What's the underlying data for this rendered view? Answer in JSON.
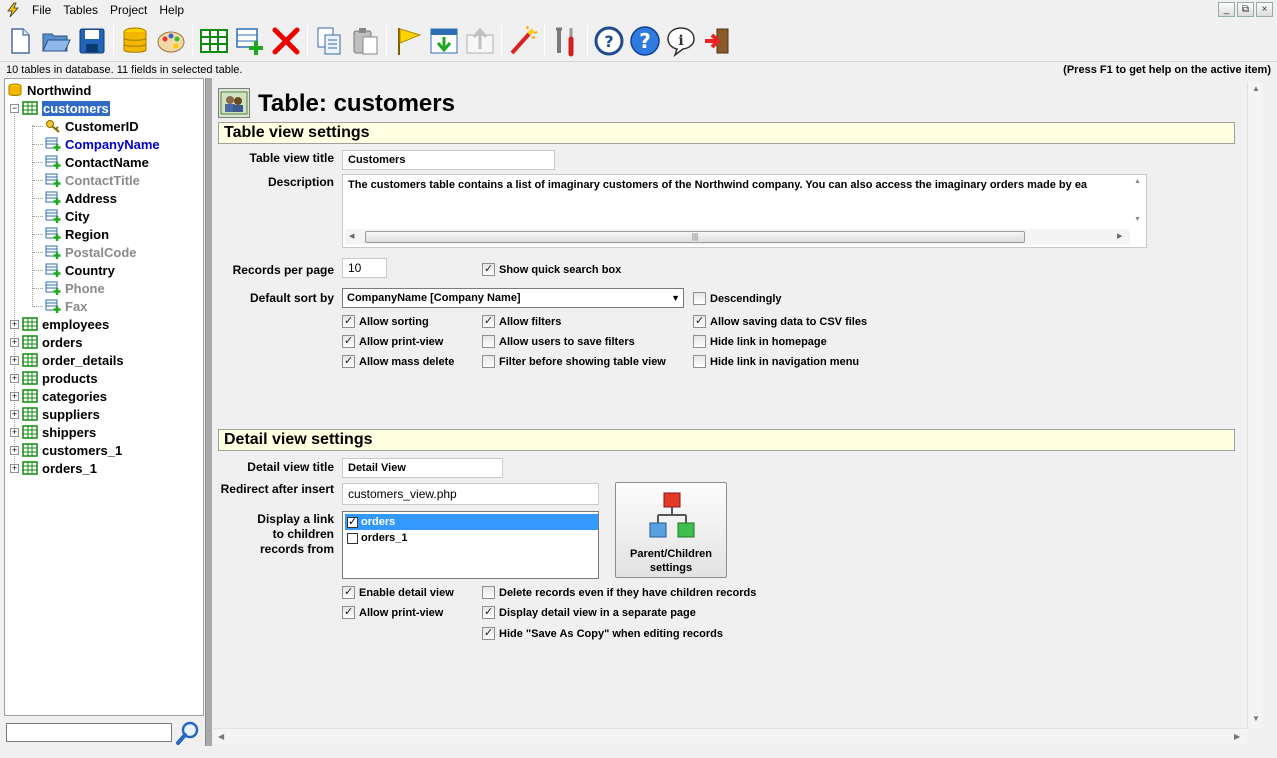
{
  "menu": [
    "File",
    "Tables",
    "Project",
    "Help"
  ],
  "window_controls": [
    "_",
    "⧉",
    "×"
  ],
  "status": {
    "left": "10 tables in database. 11 fields in selected table.",
    "right": "(Press F1 to get help on the active item)"
  },
  "tree": {
    "root": "Northwind",
    "selected_table": "customers",
    "fields": [
      {
        "name": "CustomerID",
        "state": "key"
      },
      {
        "name": "CompanyName",
        "state": "active"
      },
      {
        "name": "ContactName",
        "state": "normal"
      },
      {
        "name": "ContactTitle",
        "state": "dim"
      },
      {
        "name": "Address",
        "state": "normal"
      },
      {
        "name": "City",
        "state": "normal"
      },
      {
        "name": "Region",
        "state": "normal"
      },
      {
        "name": "PostalCode",
        "state": "dim"
      },
      {
        "name": "Country",
        "state": "normal"
      },
      {
        "name": "Phone",
        "state": "dim"
      },
      {
        "name": "Fax",
        "state": "dim"
      }
    ],
    "tables": [
      "employees",
      "orders",
      "order_details",
      "products",
      "categories",
      "suppliers",
      "shippers",
      "customers_1",
      "orders_1"
    ]
  },
  "main": {
    "title": "Table: customers",
    "table_view": {
      "heading": "Table view settings",
      "title_label": "Table view title",
      "title_value": "Customers",
      "description_label": "Description",
      "description_value": "The customers table contains a list of imaginary customers of the Northwind company. You can also access the imaginary orders made by ea",
      "records_label": "Records per page",
      "records_value": "10",
      "quick_search": "Show quick search box",
      "sort_label": "Default sort by",
      "sort_value": "CompanyName [Company Name]",
      "descending": "Descendingly",
      "checkboxes": [
        {
          "label": "Allow sorting",
          "checked": true
        },
        {
          "label": "Allow filters",
          "checked": true
        },
        {
          "label": "Allow saving data to CSV files",
          "checked": true
        },
        {
          "label": "Allow print-view",
          "checked": true
        },
        {
          "label": "Allow users to save filters",
          "checked": false
        },
        {
          "label": "Hide link in homepage",
          "checked": false
        },
        {
          "label": "Allow mass delete",
          "checked": true
        },
        {
          "label": "Filter before showing table view",
          "checked": false
        },
        {
          "label": "Hide link in navigation menu",
          "checked": false
        }
      ]
    },
    "detail_view": {
      "heading": "Detail view settings",
      "title_label": "Detail view title",
      "title_value": "Detail View",
      "redirect_label": "Redirect after insert",
      "redirect_value": "customers_view.php",
      "children_label_1": "Display a link",
      "children_label_2": "to children",
      "children_label_3": "records from",
      "children": [
        {
          "name": "orders",
          "checked": true,
          "selected": true
        },
        {
          "name": "orders_1",
          "checked": false,
          "selected": false
        }
      ],
      "pc_button_1": "Parent/Children",
      "pc_button_2": "settings",
      "checkboxes": [
        {
          "label": "Enable detail view",
          "checked": true
        },
        {
          "label": "Delete records even if they have children records",
          "checked": false
        },
        {
          "label": "Allow print-view",
          "checked": true
        },
        {
          "label": "Display detail view in a separate page",
          "checked": true
        },
        {
          "label": "Hide \"Save As Copy\" when editing records",
          "checked": true
        }
      ]
    }
  },
  "toolbar_icons": [
    "new-file-icon",
    "open-folder-icon",
    "save-icon",
    "database-icon",
    "palette-icon",
    "table-icon",
    "add-field-icon",
    "delete-icon",
    "copy-icon",
    "paste-icon",
    "flag-icon",
    "import-icon",
    "export-icon",
    "wizard-icon",
    "tools-icon",
    "help-lifebuoy-icon",
    "help-question-icon",
    "info-icon",
    "exit-icon"
  ]
}
